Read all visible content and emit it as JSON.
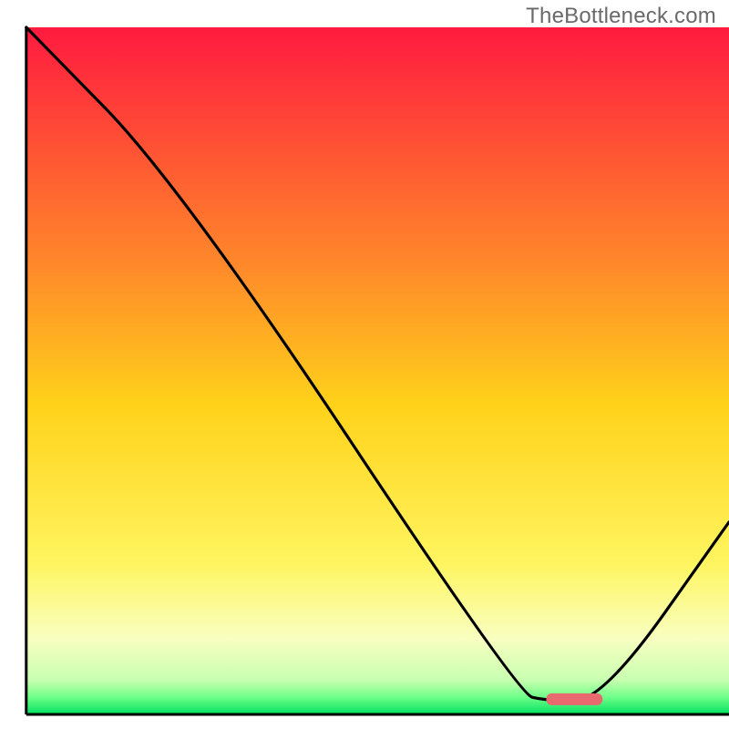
{
  "watermark": {
    "text": "TheBottleneck.com"
  },
  "chart_data": {
    "type": "line",
    "title": "",
    "xlabel": "",
    "ylabel": "",
    "xlim": [
      0,
      100
    ],
    "ylim": [
      0,
      100
    ],
    "background": {
      "gradient_stops": [
        {
          "pos": 0.0,
          "color": "#ff1a3f"
        },
        {
          "pos": 0.35,
          "color": "#ff8a2a"
        },
        {
          "pos": 0.55,
          "color": "#ffd21a"
        },
        {
          "pos": 0.78,
          "color": "#fff560"
        },
        {
          "pos": 0.89,
          "color": "#f8ffc0"
        },
        {
          "pos": 0.95,
          "color": "#c8ffb0"
        },
        {
          "pos": 0.975,
          "color": "#6eff88"
        },
        {
          "pos": 1.0,
          "color": "#00e060"
        }
      ]
    },
    "series": [
      {
        "name": "bottleneck-curve",
        "color": "#000000",
        "points": [
          {
            "x": 0,
            "y": 100
          },
          {
            "x": 22,
            "y": 77
          },
          {
            "x": 70,
            "y": 3
          },
          {
            "x": 74,
            "y": 2
          },
          {
            "x": 82,
            "y": 2
          },
          {
            "x": 100,
            "y": 28
          }
        ]
      }
    ],
    "marker": {
      "name": "optimal-range",
      "x_center": 78,
      "y": 2.2,
      "width": 8,
      "color": "#e86a6f"
    },
    "axes": {
      "left_x": 3.6,
      "bottom_y": 2.0,
      "color": "#000000"
    }
  }
}
